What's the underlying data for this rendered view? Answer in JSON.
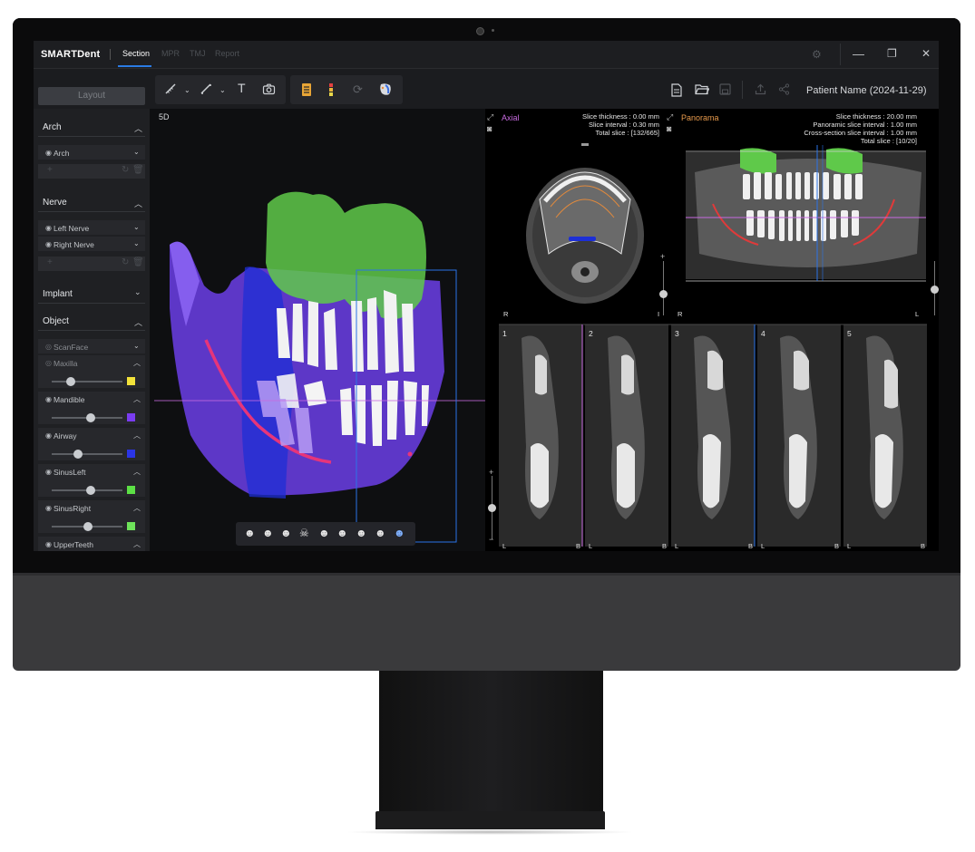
{
  "app": {
    "brand": "SMARTDent",
    "tabs": [
      {
        "label": "Section",
        "active": true
      },
      {
        "label": "MPR",
        "active": false
      },
      {
        "label": "TMJ",
        "active": false
      },
      {
        "label": "Report",
        "active": false
      }
    ],
    "window_controls": {
      "minimize": "—",
      "restore": "❐",
      "close": "✕"
    },
    "patient_name": "Patient Name (2024-11-29)"
  },
  "toolbar": {
    "icons": [
      "ruler-icon",
      "angle-measure-icon",
      "text-icon",
      "camera-icon",
      "document-layer-icon",
      "color-bar-icon",
      "reset-view-icon",
      "face-scan-icon"
    ],
    "right_icons": [
      "file-icon",
      "open-folder-icon",
      "save-icon",
      "export-icon",
      "share-icon"
    ]
  },
  "left_panel": {
    "layout_button": "Layout",
    "sections": {
      "arch": {
        "title": "Arch",
        "items": [
          {
            "label": "Arch"
          }
        ]
      },
      "nerve": {
        "title": "Nerve",
        "items": [
          {
            "label": "Left Nerve"
          },
          {
            "label": "Right Nerve"
          }
        ]
      },
      "implant": {
        "title": "Implant"
      },
      "object": {
        "title": "Object",
        "items": [
          {
            "label": "ScanFace",
            "visible": false
          },
          {
            "label": "Maxilla",
            "visible": false,
            "opacity": 0.3,
            "color": "#f2e23a"
          },
          {
            "label": "Mandible",
            "visible": true,
            "opacity": 0.6,
            "color": "#7a3cf0"
          },
          {
            "label": "Airway",
            "visible": true,
            "opacity": 0.4,
            "color": "#2b35e6"
          },
          {
            "label": "SinusLeft",
            "visible": true,
            "opacity": 0.6,
            "color": "#5ce045"
          },
          {
            "label": "SinusRight",
            "visible": true,
            "opacity": 0.55,
            "color": "#6ee35a"
          },
          {
            "label": "UpperTeeth",
            "visible": true
          }
        ]
      }
    }
  },
  "views": {
    "view3d": {
      "label": "5D"
    },
    "axial": {
      "label": "Axial",
      "color": "#c86be0",
      "info": [
        "Slice thickness : 0.00 mm",
        "Slice interval : 0.30 mm",
        "Total slice : [132/665]"
      ],
      "orient_left": "R",
      "orient_right": "I"
    },
    "panorama": {
      "label": "Panorama",
      "color": "#e79a4c",
      "info": [
        "Slice thickness : 20.00 mm",
        "Panoramic slice interval : 1.00 mm",
        "Cross-section slice interval : 1.00 mm",
        "Total slice : [10/20]"
      ],
      "orient_left": "R",
      "orient_right": "L"
    },
    "cross_sections": [
      {
        "num": "1",
        "left": "L",
        "right": "B"
      },
      {
        "num": "2",
        "left": "L",
        "right": "B"
      },
      {
        "num": "3",
        "left": "L",
        "right": "B"
      },
      {
        "num": "4",
        "left": "L",
        "right": "B"
      },
      {
        "num": "5",
        "left": "L",
        "right": "B"
      }
    ]
  },
  "bottom_tools": [
    "front-view-icon",
    "left-view-icon",
    "right-view-icon",
    "top-view-icon",
    "oblique-left-icon",
    "oblique-right-icon",
    "back-view-icon",
    "bottom-view-icon",
    "custom-view-icon"
  ]
}
